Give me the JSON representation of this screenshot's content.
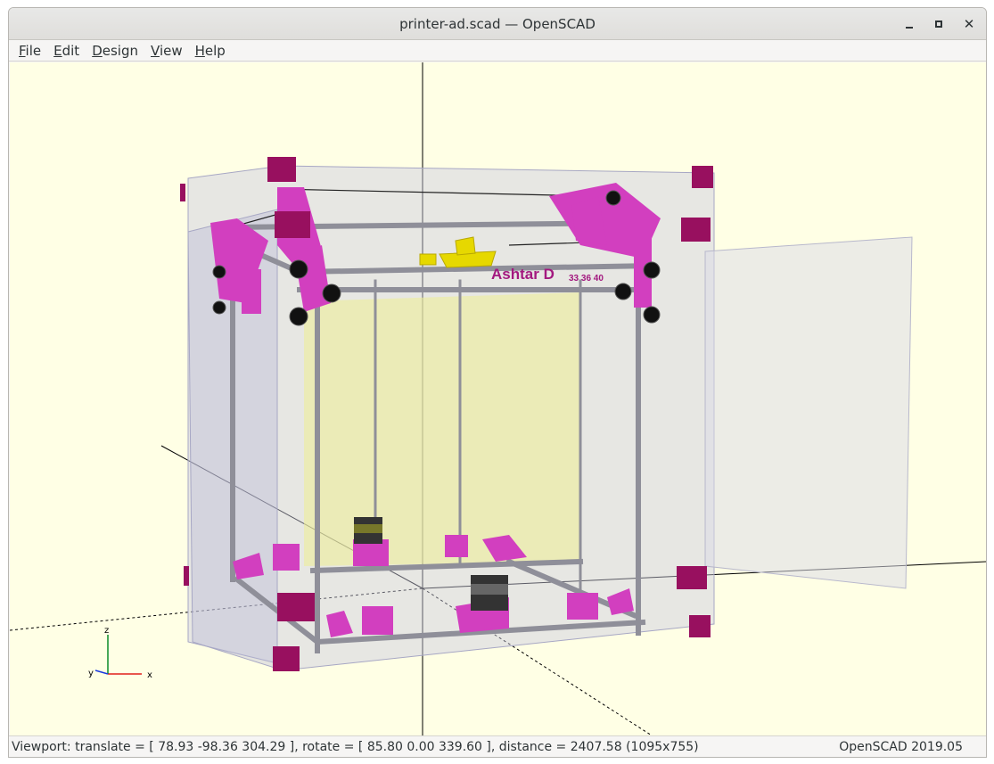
{
  "window": {
    "title": "printer-ad.scad — OpenSCAD"
  },
  "menu": {
    "items": [
      {
        "label": "File",
        "accel": "F",
        "rest": "ile"
      },
      {
        "label": "Edit",
        "accel": "E",
        "rest": "dit"
      },
      {
        "label": "Design",
        "accel": "D",
        "rest": "esign"
      },
      {
        "label": "View",
        "accel": "V",
        "rest": "iew"
      },
      {
        "label": "Help",
        "accel": "H",
        "rest": "elp"
      }
    ]
  },
  "viewport": {
    "model_label": "Ashtar D",
    "model_sublabel": "33 36 40",
    "axis_labels": {
      "x": "x",
      "y": "y",
      "z": "z"
    },
    "colors": {
      "background": "#ffffe5",
      "frame": "#9a9aa2",
      "parts": "#d23fbf",
      "corner_blocks": "#98105f",
      "panels": "#c9c9e0",
      "print_object": "#e6d800",
      "wheels": "#111111"
    }
  },
  "status": {
    "viewport_text": "Viewport: translate = [ 78.93 -98.36 304.29 ], rotate = [ 85.80 0.00 339.60 ], distance = 2407.58 (1095x755)",
    "version": "OpenSCAD 2019.05"
  },
  "icons": {
    "minimize": "minimize-icon",
    "maximize": "maximize-icon",
    "close": "close-icon"
  }
}
